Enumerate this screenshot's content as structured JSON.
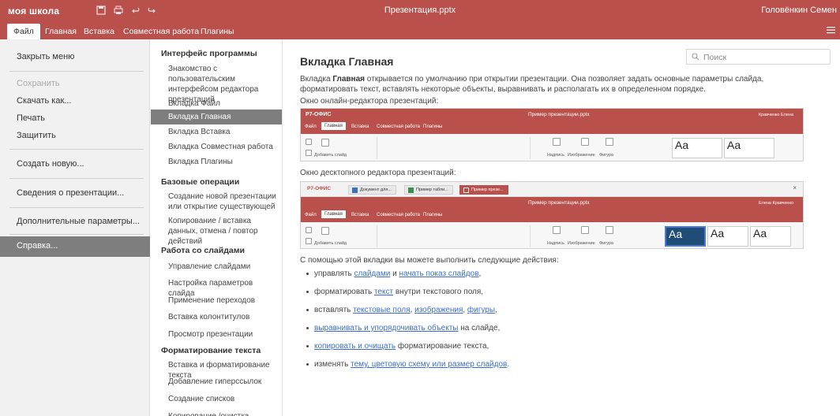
{
  "app": {
    "brand": "моя школа",
    "doc_title": "Презентация.pptx",
    "user": "Головёнкин Семен"
  },
  "menu_tabs": [
    "Файл",
    "Главная",
    "Вставка",
    "Совместная работа",
    "Плагины"
  ],
  "file_menu": {
    "close": "Закрыть меню",
    "save": "Сохранить",
    "download": "Скачать как...",
    "print": "Печать",
    "protect": "Защитить",
    "create": "Создать новую...",
    "info": "Сведения о презентации...",
    "advanced": "Дополнительные параметры...",
    "help": "Справка..."
  },
  "help_nav": {
    "s1": {
      "title": "Интерфейс программы",
      "items": [
        "Знакомство с пользовательским интерфейсом редактора презентаций",
        "Вкладка Файл",
        "Вкладка Главная",
        "Вкладка Вставка",
        "Вкладка Совместная работа",
        "Вкладка Плагины"
      ]
    },
    "s2": {
      "title": "Базовые операции",
      "items": [
        "Создание новой презентации или открытие существующей",
        "Копирование / вставка данных, отмена / повтор действий"
      ]
    },
    "s3": {
      "title": "Работа со слайдами",
      "items": [
        "Управление слайдами",
        "Настройка параметров слайда",
        "Применение переходов",
        "Вставка колонтитулов",
        "Просмотр презентации"
      ]
    },
    "s4": {
      "title": "Форматирование текста",
      "items": [
        "Вставка и форматирование текста",
        "Добавление гиперссылок",
        "Создание списков",
        "Копирование /очистка форматирования"
      ]
    }
  },
  "search": {
    "placeholder": "Поиск"
  },
  "article": {
    "title": "Вкладка Главная",
    "intro_pre": "Вкладка ",
    "intro_bold": "Главная",
    "intro_post": " открывается по умолчанию при открытии презентации. Она позволяет задать основные параметры слайда, форматировать текст, вставлять некоторые объекты, выравнивать и располагать их в определенном порядке.",
    "online_caption": "Окно онлайн-редактора презентаций:",
    "desktop_caption": "Окно десктопного редактора презентаций:",
    "actions_intro": "С помощью этой вкладки вы можете выполнить следующие действия:",
    "bullets": [
      {
        "pre": "управлять ",
        "l1": "слайдами",
        "mid": " и ",
        "l2": "начать показ слайдов",
        "post": ","
      },
      {
        "pre": "форматировать ",
        "l1": "текст",
        "post": " внутри текстового поля,"
      },
      {
        "pre": "вставлять ",
        "l1": "текстовые поля",
        "s1": ", ",
        "l2": "изображения",
        "s2": ", ",
        "l3": "фигуры",
        "post": ","
      },
      {
        "l1": "выравнивать и упорядочивать объекты",
        "post": " на слайде,"
      },
      {
        "l1": "копировать и очищать",
        "post": " форматирование текста,"
      },
      {
        "pre": "изменять ",
        "l1": "тему, цветовую схему или размер слайдов",
        "post": "."
      }
    ]
  },
  "shot_online": {
    "logo": "Р7-ОФИС",
    "title": "Пример презентации.pptx",
    "user": "Кравченко Елена",
    "tabs": [
      "Файл",
      "Главная",
      "Вставка",
      "Совместная работа",
      "Плагины"
    ],
    "add_slide": "Добавить слайд",
    "label": "Надпись",
    "image": "Изображение",
    "shape": "Фигура",
    "aa": "Aa"
  },
  "shot_desktop": {
    "logo": "Р7-ОФИС",
    "doc_tabs": [
      "Документ для...",
      "Пример табли...",
      "Пример презе..."
    ],
    "title": "Пример презентации.pptx",
    "user": "Елена Кравченко",
    "tabs": [
      "Файл",
      "Главная",
      "Вставка",
      "Совместная работа",
      "Плагины"
    ],
    "add_slide": "Добавить слайд",
    "label": "Надпись",
    "image": "Изображение",
    "shape": "Фигура",
    "aa": "Aa",
    "close_x": "×"
  },
  "colors": {
    "accent": "#b9504c",
    "selected": "#7e7e7e",
    "link": "#3c6ec8"
  }
}
